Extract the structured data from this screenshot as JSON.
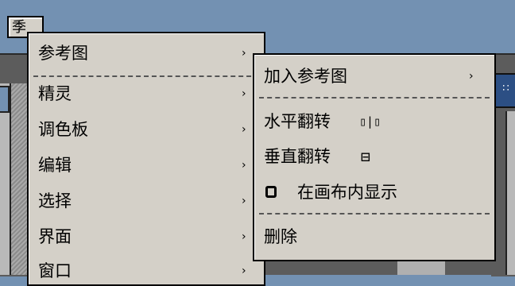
{
  "toolbar": {
    "tool_label": "季"
  },
  "right_tab": {
    "glyph": "∷"
  },
  "main_menu": {
    "items": [
      {
        "label": "参考图",
        "arrow": "›"
      },
      {
        "label": "精灵",
        "arrow": "›"
      },
      {
        "label": "调色板",
        "arrow": "›"
      },
      {
        "label": "编辑",
        "arrow": "›"
      },
      {
        "label": "选择",
        "arrow": "›"
      },
      {
        "label": "界面",
        "arrow": "›"
      },
      {
        "label": "窗口",
        "arrow": "›"
      }
    ]
  },
  "sub_menu": {
    "add_reference": {
      "label": "加入参考图",
      "arrow": "›"
    },
    "flip_horizontal": {
      "label": "水平翻转",
      "icon": "flip-horizontal-icon",
      "icon_glyph": "▯|▯"
    },
    "flip_vertical": {
      "label": "垂直翻转",
      "icon": "flip-vertical-icon",
      "icon_glyph": "⊟"
    },
    "show_in_canvas": {
      "label": "在画布内显示",
      "checked": false
    },
    "delete": {
      "label": "删除"
    }
  }
}
